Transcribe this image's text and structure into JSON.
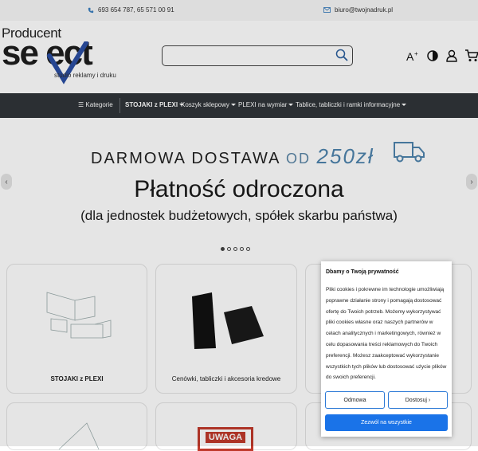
{
  "topbar": {
    "phone": "693 654 787, 65 571 00 91",
    "email": "biuro@twojnadruk.pl"
  },
  "logo": {
    "producent": "Producent",
    "brand": "se ect",
    "tagline": "studio reklamy i druku"
  },
  "search": {
    "placeholder": ""
  },
  "header_icons": [
    "font-size-icon",
    "contrast-icon",
    "user-icon",
    "cart-icon"
  ],
  "nav": {
    "categories": "Kategorie",
    "items": [
      {
        "label": "STOJAKI z PLEXI"
      },
      {
        "label": "Koszyk sklepowy"
      },
      {
        "label": "PLEXI na wymiar"
      },
      {
        "label": "Tablice, tabliczki i ramki informacyjne"
      }
    ]
  },
  "hero": {
    "shipping_text": "DARMOWA DOSTAWA",
    "shipping_od": "OD",
    "shipping_amount": "250zł",
    "heading": "Płatność odroczona",
    "subheading": "(dla jednostek budżetowych, spółek skarbu państwa)",
    "slides": 5,
    "active_slide": 1
  },
  "products": [
    {
      "title": "STOJAKI z PLEXI"
    },
    {
      "title": "Cenówki, tabliczki i akcesoria kredowe"
    }
  ],
  "lower_card_text": "UWAGA",
  "cookie": {
    "title": "Dbamy o Twoją prywatność",
    "body": "Pliki cookies i pokrewne im technologie umożliwiają poprawne działanie strony i pomagają dostosować ofertę do Twoich potrzeb. Możemy wykorzystywać pliki cookies własne oraz naszych partnerów w celach analitycznych i marketingowych, również w celu dopasowania treści reklamowych do Twoich preferencji. Możesz zaakceptować wykorzystanie wszystkich tych plików lub dostosować użycie plików do swoich preferencji.",
    "reject": "Odmowa",
    "customize": "Dostosuj ›",
    "accept": "Zezwól na wszystkie"
  },
  "colors": {
    "nav_bg": "#303539",
    "accent_blue": "#1a73e8",
    "logo_check": "#2b4fa3",
    "amount_blue": "#4f84ad"
  }
}
